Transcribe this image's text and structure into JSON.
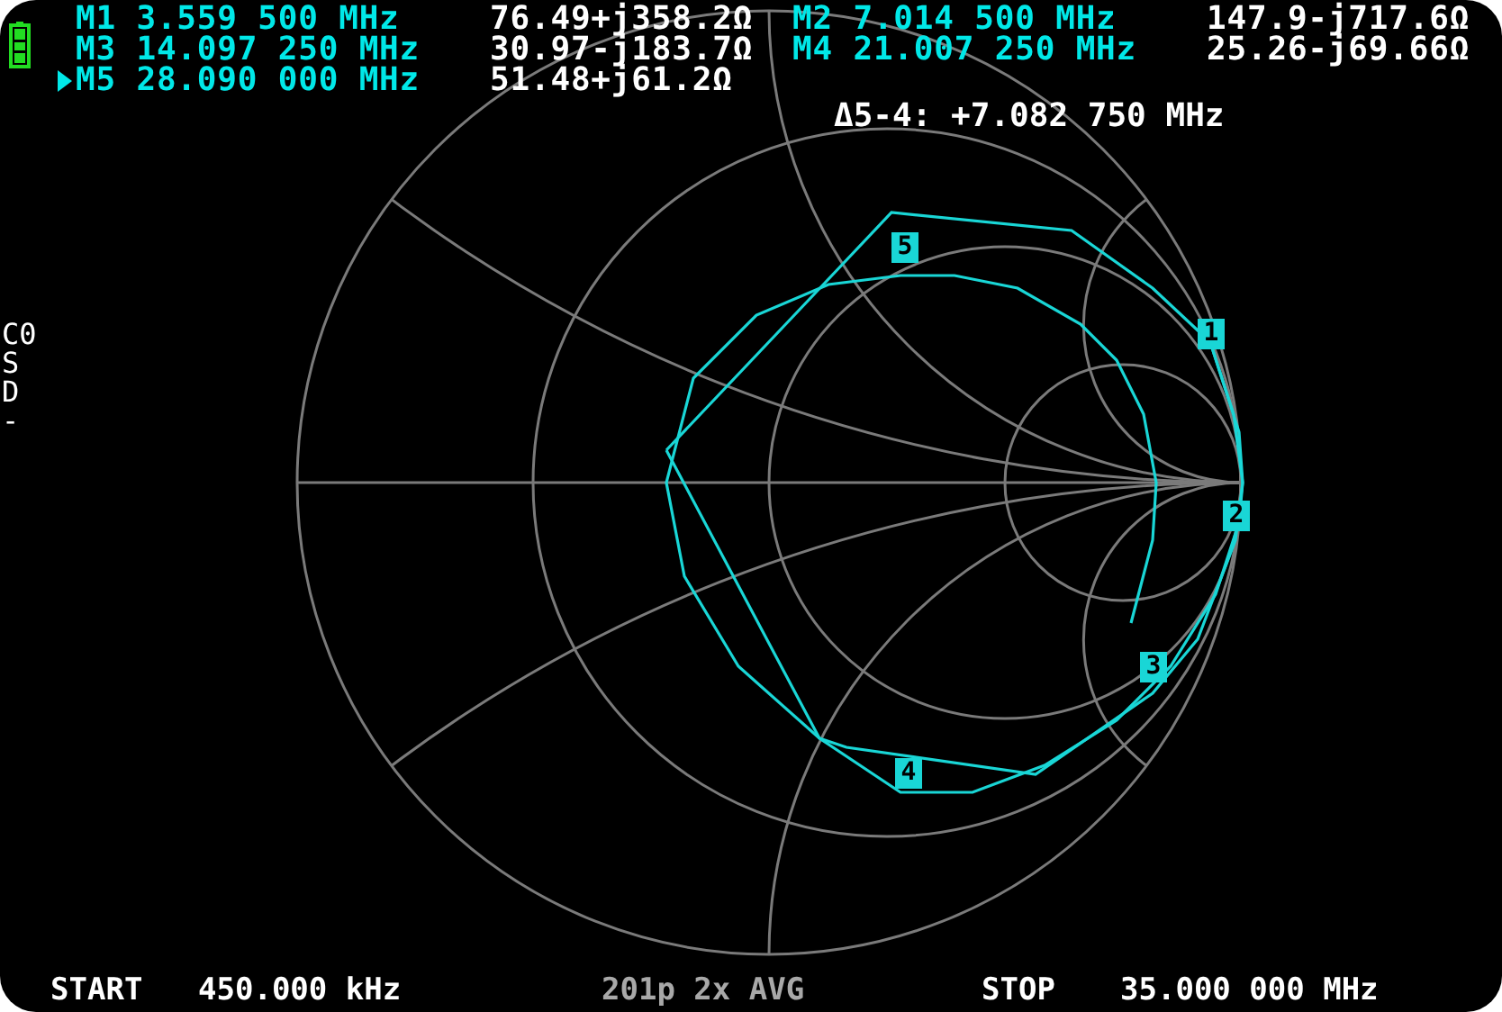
{
  "battery": {
    "level": 1
  },
  "markers": [
    {
      "label": "M1",
      "frequency": "3.559 500 MHz",
      "impedance": "76.49+j358.2Ω",
      "selected": false
    },
    {
      "label": "M2",
      "frequency": "7.014 500 MHz",
      "impedance": "147.9-j717.6Ω",
      "selected": false
    },
    {
      "label": "M3",
      "frequency": "14.097 250 MHz",
      "impedance": "30.97-j183.7Ω",
      "selected": false
    },
    {
      "label": "M4",
      "frequency": "21.007 250 MHz",
      "impedance": "25.26-j69.66Ω",
      "selected": false
    },
    {
      "label": "M5",
      "frequency": "28.090 000 MHz",
      "impedance": "51.48+j61.2Ω",
      "selected": true
    }
  ],
  "delta": "Δ5-4: +7.082 750 MHz",
  "side_labels": [
    "C0",
    "S",
    "D",
    "-"
  ],
  "chart_markers": [
    "5",
    "1",
    "2",
    "3",
    "4"
  ],
  "status_bar": {
    "start_label": "START",
    "start_value": "450.000 kHz",
    "info": "201p 2x AVG",
    "stop_label": "STOP",
    "stop_value": "35.000 000 MHz"
  }
}
